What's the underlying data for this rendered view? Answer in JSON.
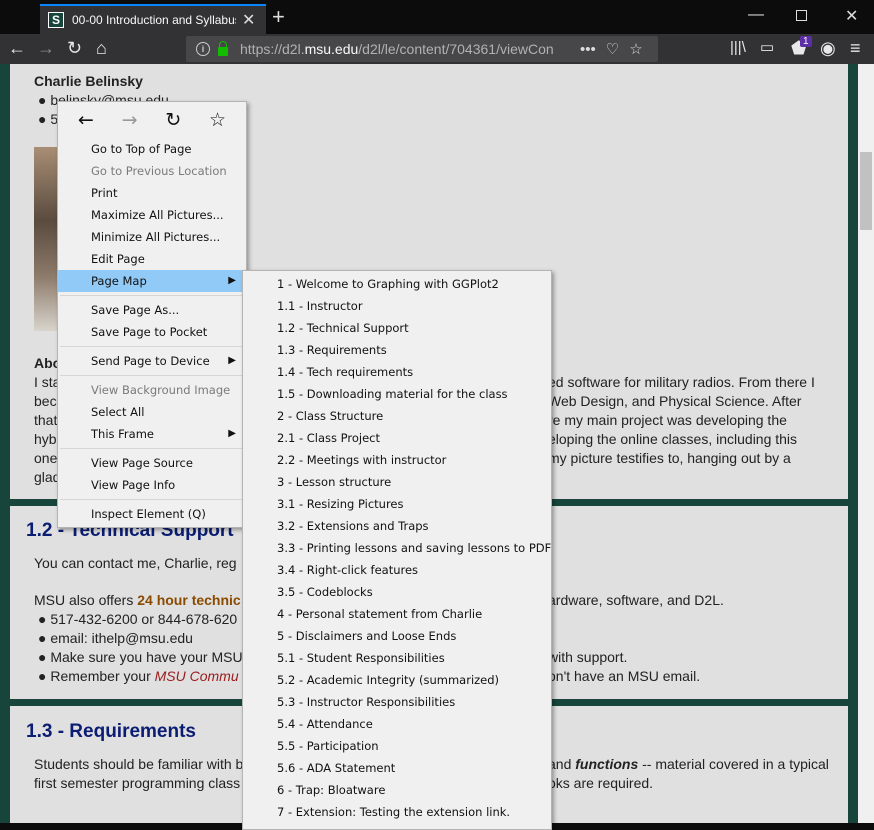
{
  "browser": {
    "tab_title": "00-00 Introduction and Syllabus",
    "favicon_letter": "S",
    "url_domain_pre": "https://d2l.",
    "url_domain": "msu.edu",
    "url_path": "/d2l/le/content/704361/viewCon",
    "notification_count": "1"
  },
  "page": {
    "person_name": "Charlie Belinsky",
    "email_partial": "belinsky@msu.edu",
    "about_lines": [
      "I sta",
      "bec",
      "that",
      "hyb",
      "one",
      "glad"
    ],
    "about_heading_partial": "Abo",
    "about_right_lines": [
      "ed software for military radios. From there I",
      "Web Design, and Physical Science. After",
      "re my main project was developing the",
      "eloping the online classes, including this",
      "my picture testifies to, hanging out by a"
    ],
    "section_12_title": "1.2 - Technical Support",
    "contact_partial": "You can contact me, Charlie, reg",
    "msu_offers_prefix": "MSU also offers ",
    "msu_offers_bold": "24 hour technic",
    "msu_offers_right": "ardware, software, and D2L.",
    "bullets_12": [
      {
        "left": "517-432-6200 or 844-678-620",
        "right": ""
      },
      {
        "left": "email: ithelp@msu.edu",
        "right": ""
      },
      {
        "left": "Make sure you have your MSU",
        "right": "with support."
      },
      {
        "left": "Remember your ",
        "link": "MSU Commu",
        "right": "on't have an MSU email."
      }
    ],
    "section_13_title": "1.3 - Requirements",
    "req_line1_left": "Students should be familiar with b",
    "req_line1_right_pre": "and ",
    "req_line1_right_em": "functions",
    "req_line1_right_post": " -- material covered in a typical",
    "req_line2_left": "first semester programming class",
    "req_line2_right": "oks are required."
  },
  "context_menu": {
    "items": [
      {
        "label": "Go to Top of Page",
        "disabled": false
      },
      {
        "label": "Go to Previous Location",
        "disabled": true
      },
      {
        "label": "Print",
        "disabled": false
      },
      {
        "label": "Maximize All Pictures...",
        "disabled": false
      },
      {
        "label": "Minimize All Pictures...",
        "disabled": false
      },
      {
        "label": "Edit Page",
        "disabled": false
      },
      {
        "label": "Page Map",
        "disabled": false,
        "submenu": true,
        "highlighted": true
      },
      {
        "sep": true
      },
      {
        "label": "Save Page As...",
        "disabled": false
      },
      {
        "label": "Save Page to Pocket",
        "disabled": false
      },
      {
        "sep": true
      },
      {
        "label": "Send Page to Device",
        "disabled": false,
        "submenu": true
      },
      {
        "sep": true
      },
      {
        "label": "View Background Image",
        "disabled": true
      },
      {
        "label": "Select All",
        "disabled": false
      },
      {
        "label": "This Frame",
        "disabled": false,
        "submenu": true
      },
      {
        "sep": true
      },
      {
        "label": "View Page Source",
        "disabled": false
      },
      {
        "label": "View Page Info",
        "disabled": false
      },
      {
        "sep": true
      },
      {
        "label": "Inspect Element (Q)",
        "disabled": false
      }
    ]
  },
  "page_map": [
    "1 - Welcome to Graphing with GGPlot2",
    "1.1 - Instructor",
    "1.2 - Technical Support",
    "1.3 - Requirements",
    "1.4 - Tech requirements",
    "1.5 - Downloading material for the class",
    "2 - Class Structure",
    "2.1 - Class Project",
    "2.2 - Meetings with instructor",
    "3 - Lesson structure",
    "3.1 - Resizing Pictures",
    "3.2 - Extensions and Traps",
    "3.3 - Printing lessons and saving lessons to PDF",
    "3.4 - Right-click features",
    "3.5 - Codeblocks",
    "4 - Personal statement from Charlie",
    "5 - Disclaimers and Loose Ends",
    "5.1 - Student Responsibilities",
    "5.2 - Academic Integrity (summarized)",
    "5.3 - Instructor Responsibilities",
    "5.4 - Attendance",
    "5.5 - Participation",
    "5.6 - ADA Statement",
    "6 - Trap: Bloatware",
    "7 - Extension: Testing the extension link."
  ]
}
